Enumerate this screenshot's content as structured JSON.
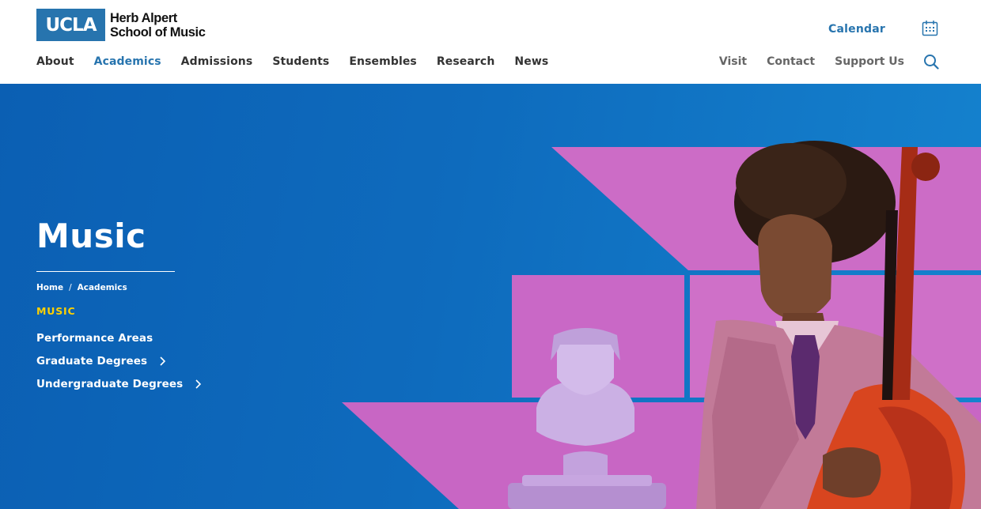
{
  "logo": {
    "mark": "UCLA",
    "line1": "Herb Alpert",
    "line2": "School of Music"
  },
  "header": {
    "calendar_label": "Calendar",
    "main_nav": [
      {
        "label": "About"
      },
      {
        "label": "Academics"
      },
      {
        "label": "Admissions"
      },
      {
        "label": "Students"
      },
      {
        "label": "Ensembles"
      },
      {
        "label": "Research"
      },
      {
        "label": "News"
      }
    ],
    "utility_nav": [
      {
        "label": "Visit"
      },
      {
        "label": "Contact"
      },
      {
        "label": "Support Us"
      }
    ],
    "icons": {
      "calendar": "calendar-icon",
      "search": "search-icon"
    }
  },
  "hero": {
    "title": "Music",
    "breadcrumb": [
      {
        "label": "Home"
      },
      {
        "label": "Academics"
      }
    ],
    "breadcrumb_separator": "/",
    "current_section": "MUSIC",
    "links": [
      {
        "label": "Performance Areas"
      },
      {
        "label": "Graduate Degrees"
      },
      {
        "label": "Undergraduate Degrees"
      }
    ]
  },
  "colors": {
    "brand_blue": "#2774ae",
    "hero_blue": "#0e6bbd",
    "highlight_yellow": "#ffd100",
    "panel_pink": "#cc6cc6"
  }
}
